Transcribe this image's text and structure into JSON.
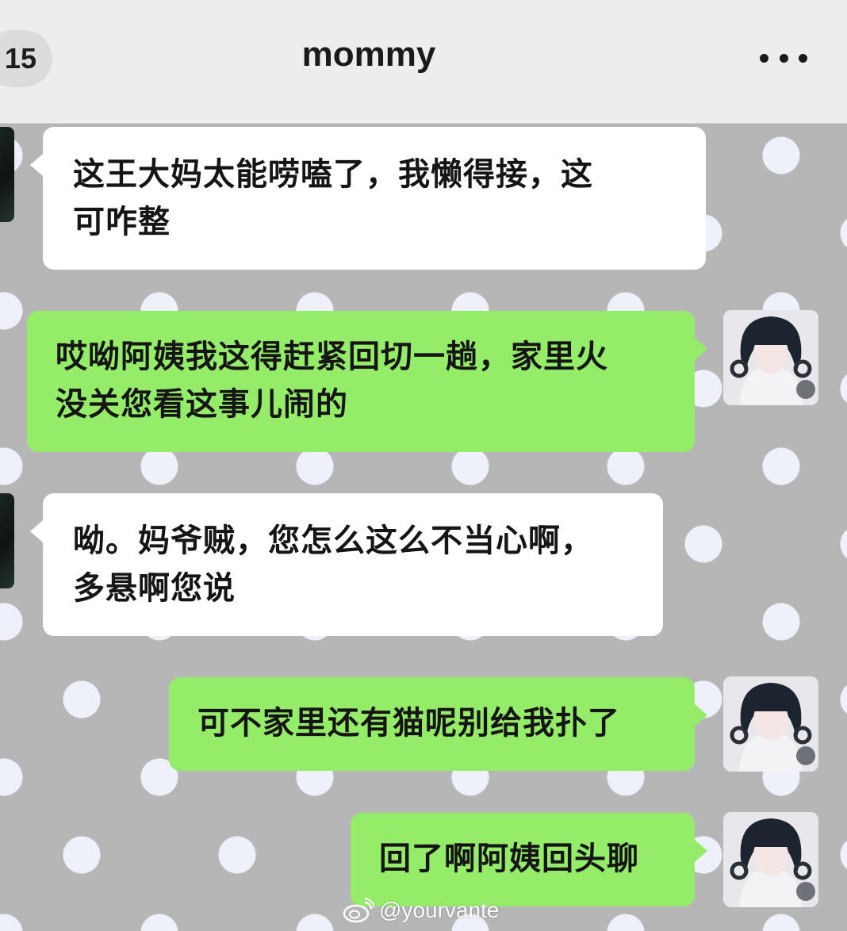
{
  "header": {
    "back_count": "15",
    "title": "mommy",
    "more_icon": "more-horizontal-icon"
  },
  "colors": {
    "header_bg": "#ededed",
    "chat_bg": "#b6b6b6",
    "incoming_bubble": "#ffffff",
    "outgoing_bubble": "#95ec69"
  },
  "messages": [
    {
      "direction": "incoming",
      "lines": [
        "这王大妈太能唠嗑了，我懒得接，这",
        "可咋整"
      ]
    },
    {
      "direction": "outgoing",
      "lines": [
        "哎呦阿姨我这得赶紧回切一趟，家里火",
        "没关您看这事儿闹的"
      ]
    },
    {
      "direction": "incoming",
      "lines": [
        "呦。妈爷贼，您怎么这么不当心啊，",
        "多悬啊您说"
      ]
    },
    {
      "direction": "outgoing",
      "lines": [
        "可不家里还有猫呢别给我扑了"
      ]
    },
    {
      "direction": "outgoing",
      "lines": [
        "回了啊阿姨回头聊"
      ]
    }
  ],
  "watermark": {
    "icon": "weibo-icon",
    "text": "@yourvante"
  }
}
